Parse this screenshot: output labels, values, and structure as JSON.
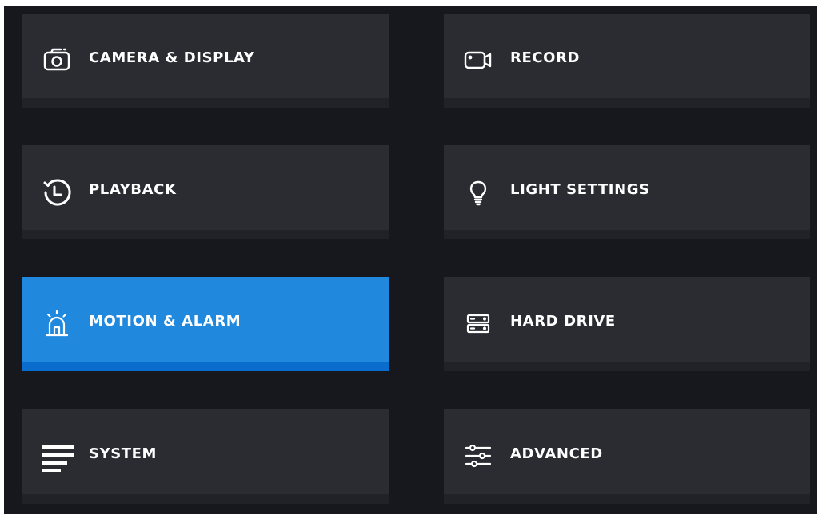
{
  "menu": {
    "items": [
      {
        "id": "camera-display",
        "label": "CAMERA & DISPLAY",
        "icon": "camera-icon",
        "active": false
      },
      {
        "id": "record",
        "label": "RECORD",
        "icon": "video-record-icon",
        "active": false
      },
      {
        "id": "playback",
        "label": "PLAYBACK",
        "icon": "history-clock-icon",
        "active": false
      },
      {
        "id": "light-settings",
        "label": "LIGHT SETTINGS",
        "icon": "lightbulb-icon",
        "active": false
      },
      {
        "id": "motion-alarm",
        "label": "MOTION & ALARM",
        "icon": "alarm-beacon-icon",
        "active": true
      },
      {
        "id": "hard-drive",
        "label": "HARD DRIVE",
        "icon": "hard-drive-icon",
        "active": false
      },
      {
        "id": "system",
        "label": "SYSTEM",
        "icon": "menu-lines-icon",
        "active": false
      },
      {
        "id": "advanced",
        "label": "ADVANCED",
        "icon": "sliders-icon",
        "active": false
      }
    ]
  },
  "colors": {
    "background": "#16181d",
    "tile": "#2a2c31",
    "tile_active": "#2089de",
    "text": "#ffffff"
  }
}
